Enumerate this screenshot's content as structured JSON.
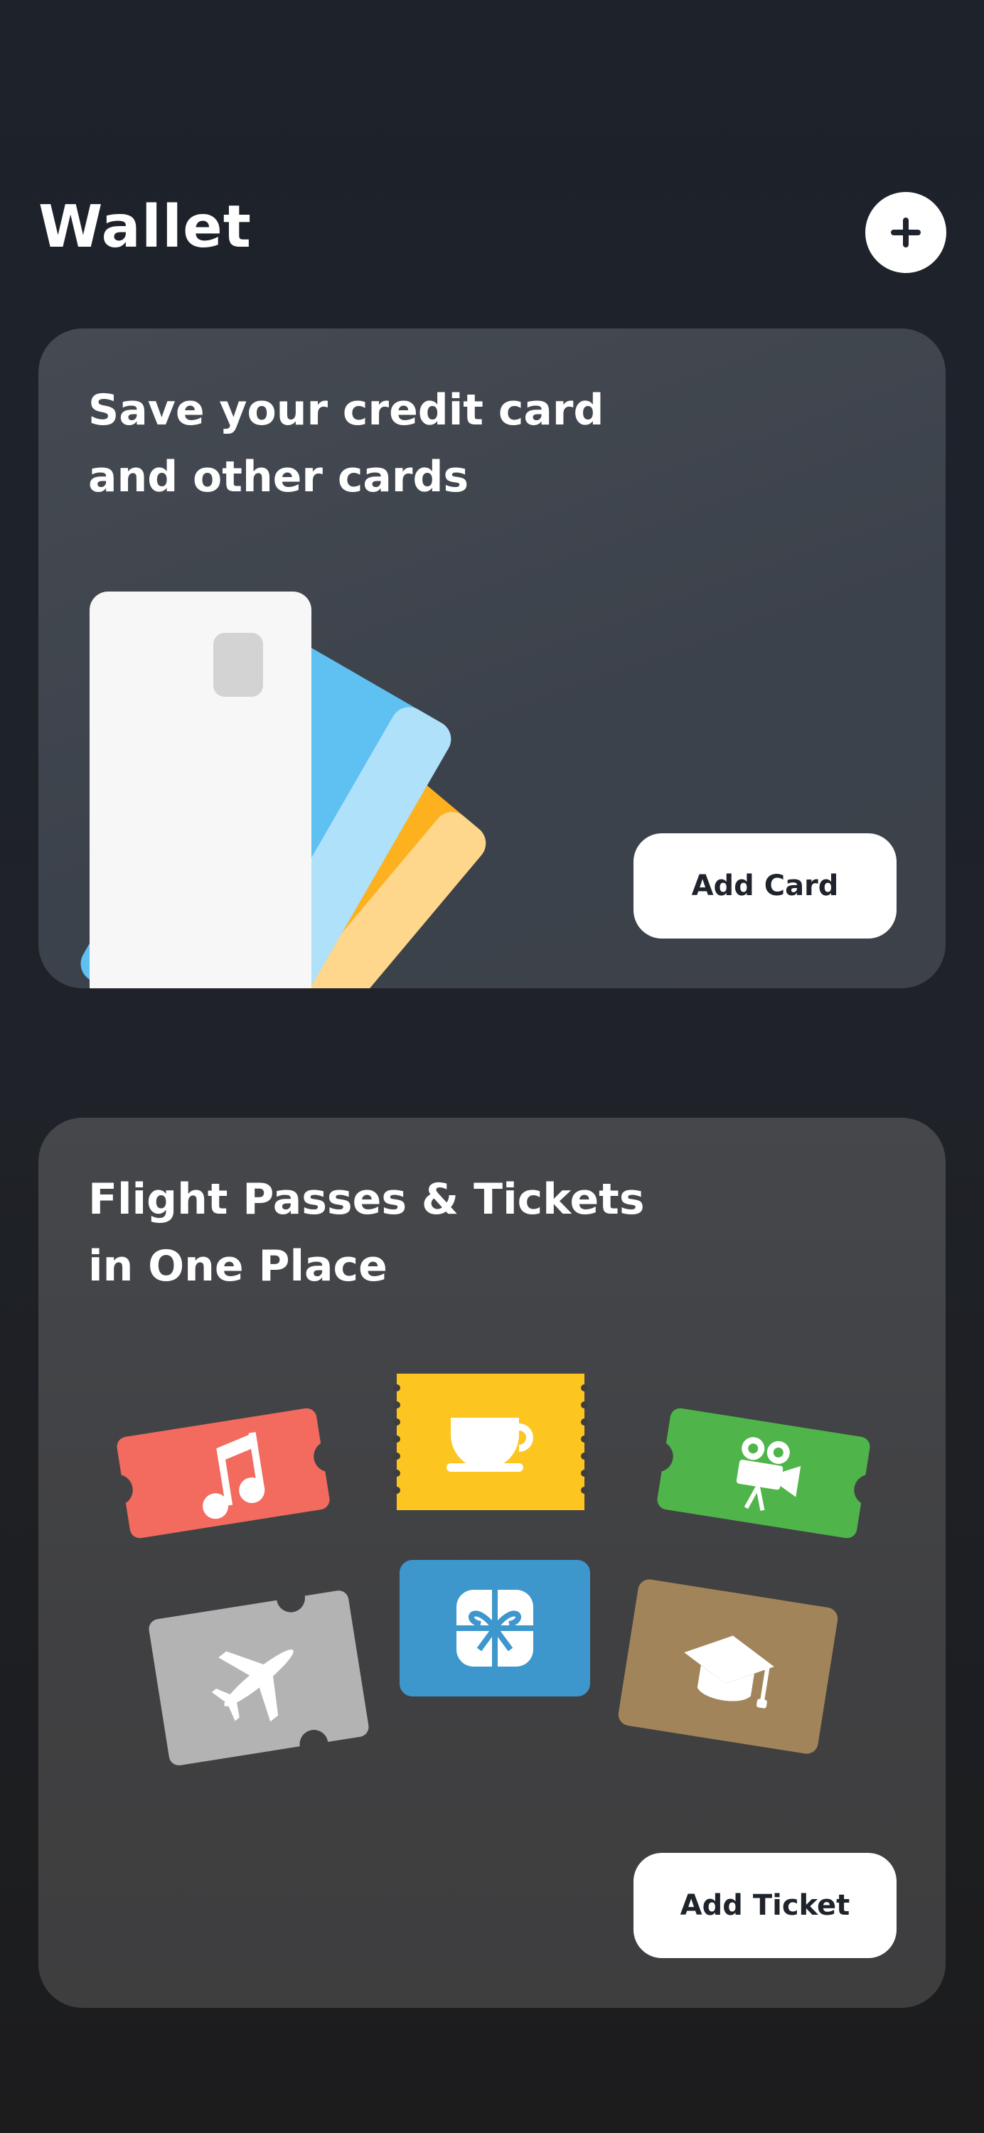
{
  "header": {
    "title": "Wallet",
    "add_icon": "plus-icon"
  },
  "cards_panel": {
    "title": "Save your credit card\nand other cards",
    "button_label": "Add Card",
    "illustration": "credit-cards-fan",
    "colors": {
      "white_card": "#f7f7f7",
      "chip": "#d3d3d3",
      "blue_card": "#5fc0f2",
      "blue_edge": "#b0e1fa",
      "orange_card": "#fdb11e",
      "orange_edge": "#ffd78c"
    }
  },
  "tickets_panel": {
    "title": "Flight Passes & Tickets\nin One Place",
    "button_label": "Add Ticket",
    "tickets": [
      {
        "icon": "music-note-icon",
        "color": "#f26b5e"
      },
      {
        "icon": "coffee-cup-icon",
        "color": "#fcc520"
      },
      {
        "icon": "movie-camera-icon",
        "color": "#4fb54a"
      },
      {
        "icon": "airplane-icon",
        "color": "#b3b3b3"
      },
      {
        "icon": "gift-icon",
        "color": "#3d97cc"
      },
      {
        "icon": "graduation-cap-icon",
        "color": "#a2845a"
      }
    ]
  }
}
